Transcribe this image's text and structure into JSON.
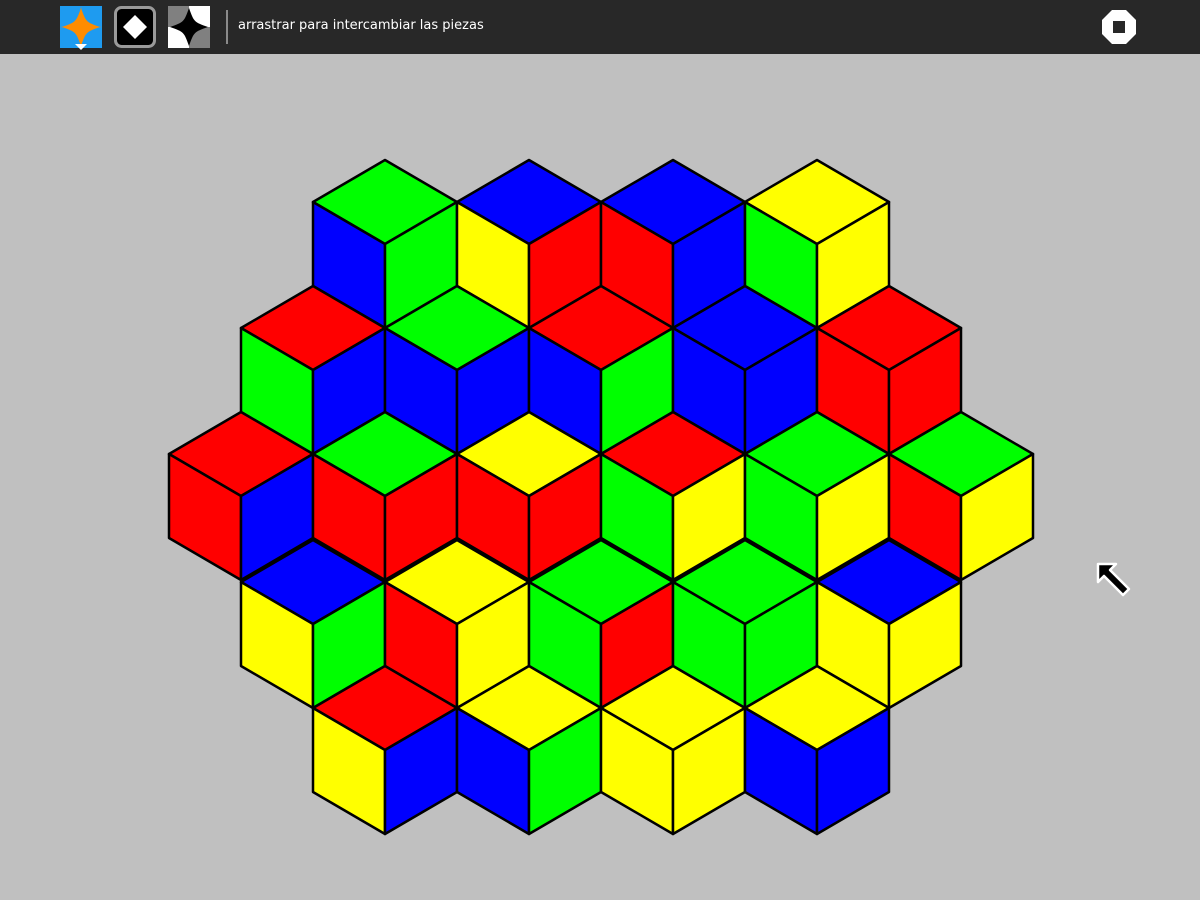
{
  "toolbar": {
    "hint": "arrastrar para intercambiar las piezas",
    "modes": [
      {
        "name": "color-mode",
        "icon": "four-color-star-icon",
        "active": true
      },
      {
        "name": "diamond-mode",
        "icon": "white-diamond-icon",
        "active": false
      },
      {
        "name": "bw-mode",
        "icon": "black-white-star-icon",
        "active": false
      }
    ],
    "stop_icon": "stop-icon"
  },
  "colors": {
    "R": "#ff0000",
    "G": "#00ff00",
    "B": "#0000ff",
    "Y": "#ffff00",
    "background": "#c0c0c0",
    "toolbar": "#282828",
    "outline": "#000000"
  },
  "board": {
    "rows": [
      [
        [
          "G",
          "B",
          "G"
        ],
        [
          "B",
          "Y",
          "R"
        ],
        [
          "B",
          "R",
          "B"
        ],
        [
          "Y",
          "G",
          "Y"
        ]
      ],
      [
        [
          "R",
          "G",
          "B"
        ],
        [
          "G",
          "B",
          "B"
        ],
        [
          "R",
          "B",
          "G"
        ],
        [
          "B",
          "B",
          "B"
        ],
        [
          "R",
          "R",
          "R"
        ]
      ],
      [
        [
          "R",
          "R",
          "B"
        ],
        [
          "G",
          "R",
          "R"
        ],
        [
          "Y",
          "R",
          "R"
        ],
        [
          "R",
          "G",
          "Y"
        ],
        [
          "G",
          "G",
          "Y"
        ],
        [
          "G",
          "R",
          "Y"
        ]
      ],
      [
        [
          "B",
          "Y",
          "G"
        ],
        [
          "Y",
          "R",
          "Y"
        ],
        [
          "G",
          "G",
          "R"
        ],
        [
          "G",
          "G",
          "G"
        ],
        [
          "B",
          "Y",
          "Y"
        ]
      ],
      [
        [
          "R",
          "Y",
          "B"
        ],
        [
          "Y",
          "B",
          "G"
        ],
        [
          "Y",
          "Y",
          "Y"
        ],
        [
          "Y",
          "B",
          "B"
        ]
      ]
    ]
  }
}
